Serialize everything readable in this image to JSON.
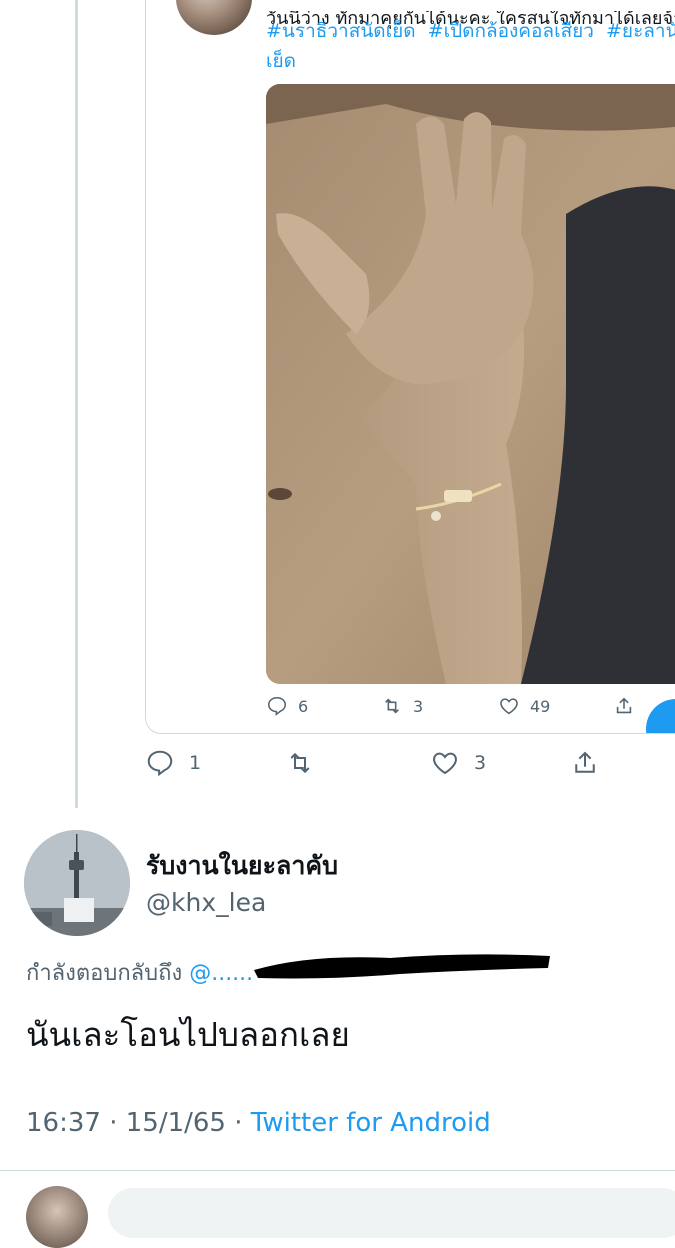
{
  "quoted_tweet": {
    "text_cut_off": "วันนี้ว่าง ทักมาคุยกันได้นะคะ ใครสนใจทักมาได้เลยจ้า",
    "hashtags": [
      "#นราธิวาสนัดเย็ด",
      "#เปิดกล้องคอลเสียว",
      "#ยะลานัดเย็ด"
    ],
    "media_alt": "",
    "stats": {
      "replies": "6",
      "retweets": "3",
      "likes": "49"
    }
  },
  "reply_actions": {
    "replies": "1",
    "retweets": "",
    "likes": "3"
  },
  "author": {
    "display_name": "รับงานในยะลาคับ",
    "handle": "@khx_lea"
  },
  "replying_to": {
    "label": "กำลังตอบกลับถึง",
    "mention": "@......"
  },
  "tweet": {
    "text": "นันเละโอนไปบลอกเลย",
    "time": "16:37",
    "separator": " · ",
    "date": "15/1/65",
    "client": "Twitter for Android"
  },
  "colors": {
    "link": "#1d9bf0",
    "secondary": "#536471",
    "border": "#cfd9de"
  },
  "icons": {
    "reply": "reply-icon",
    "retweet": "retweet-icon",
    "like": "heart-icon",
    "share": "share-icon"
  }
}
